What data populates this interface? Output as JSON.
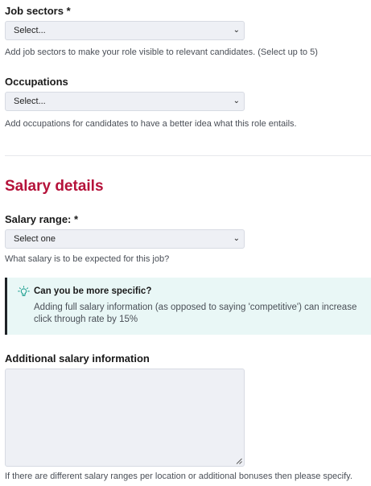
{
  "job_sectors": {
    "label": "Job sectors *",
    "select_value": "Select...",
    "help": "Add job sectors to make your role visible to relevant candidates. (Select up to 5)"
  },
  "occupations": {
    "label": "Occupations",
    "select_value": "Select...",
    "help": "Add occupations for candidates to have a better idea what this role entails."
  },
  "salary_details": {
    "title": "Salary details",
    "title_color": "#b5123a"
  },
  "salary_range": {
    "label": "Salary range: *",
    "select_value": "Select one",
    "help": "What salary is to be expected for this job?"
  },
  "callout": {
    "icon": "lightbulb-icon",
    "title": "Can you be more specific?",
    "body": "Adding full salary information (as opposed to saying 'competitive') can increase click through rate by 15%",
    "background": "#e9f7f6"
  },
  "additional_salary": {
    "label": "Additional salary information",
    "value": "",
    "help": "If there are different salary ranges per location or additional bonuses then please specify."
  }
}
